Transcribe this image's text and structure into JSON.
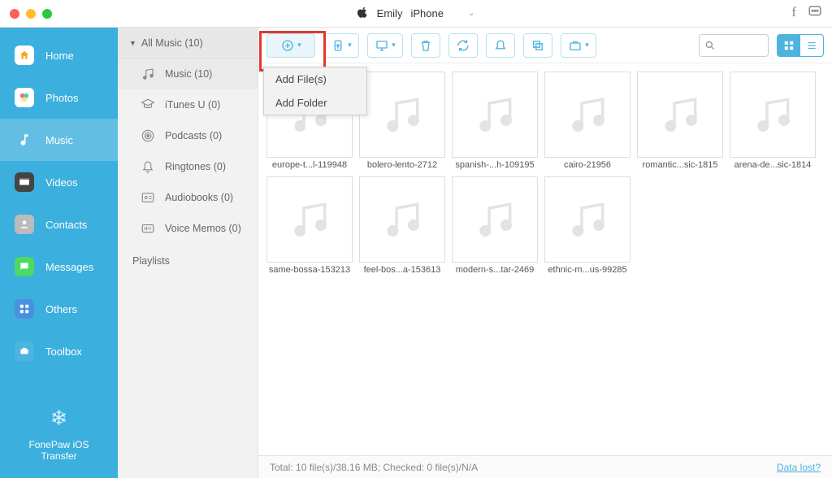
{
  "titlebar": {
    "device_owner": "Emily",
    "device_model": "iPhone"
  },
  "sidebar": {
    "items": [
      {
        "label": "Home"
      },
      {
        "label": "Photos"
      },
      {
        "label": "Music"
      },
      {
        "label": "Videos"
      },
      {
        "label": "Contacts"
      },
      {
        "label": "Messages"
      },
      {
        "label": "Others"
      },
      {
        "label": "Toolbox"
      }
    ],
    "footer": "FonePaw iOS Transfer"
  },
  "midcol": {
    "header": "All Music (10)",
    "items": [
      {
        "label": "Music (10)"
      },
      {
        "label": "iTunes U (0)"
      },
      {
        "label": "Podcasts (0)"
      },
      {
        "label": "Ringtones (0)"
      },
      {
        "label": "Audiobooks (0)"
      },
      {
        "label": "Voice Memos (0)"
      }
    ],
    "playlists_label": "Playlists"
  },
  "dropdown": {
    "add_files": "Add File(s)",
    "add_folder": "Add Folder"
  },
  "files": [
    {
      "name": "europe-t...l-119948"
    },
    {
      "name": "bolero-lento-2712"
    },
    {
      "name": "spanish-...h-109195"
    },
    {
      "name": "cairo-21956"
    },
    {
      "name": "romantic...sic-1815"
    },
    {
      "name": "arena-de...sic-1814"
    },
    {
      "name": "same-bossa-153213"
    },
    {
      "name": "feel-bos...a-153613"
    },
    {
      "name": "modern-s...tar-2469"
    },
    {
      "name": "ethnic-m...us-99285"
    }
  ],
  "statusbar": {
    "text": "Total: 10 file(s)/38.16 MB; Checked: 0 file(s)/N/A",
    "data_lost": "Data lost?"
  }
}
